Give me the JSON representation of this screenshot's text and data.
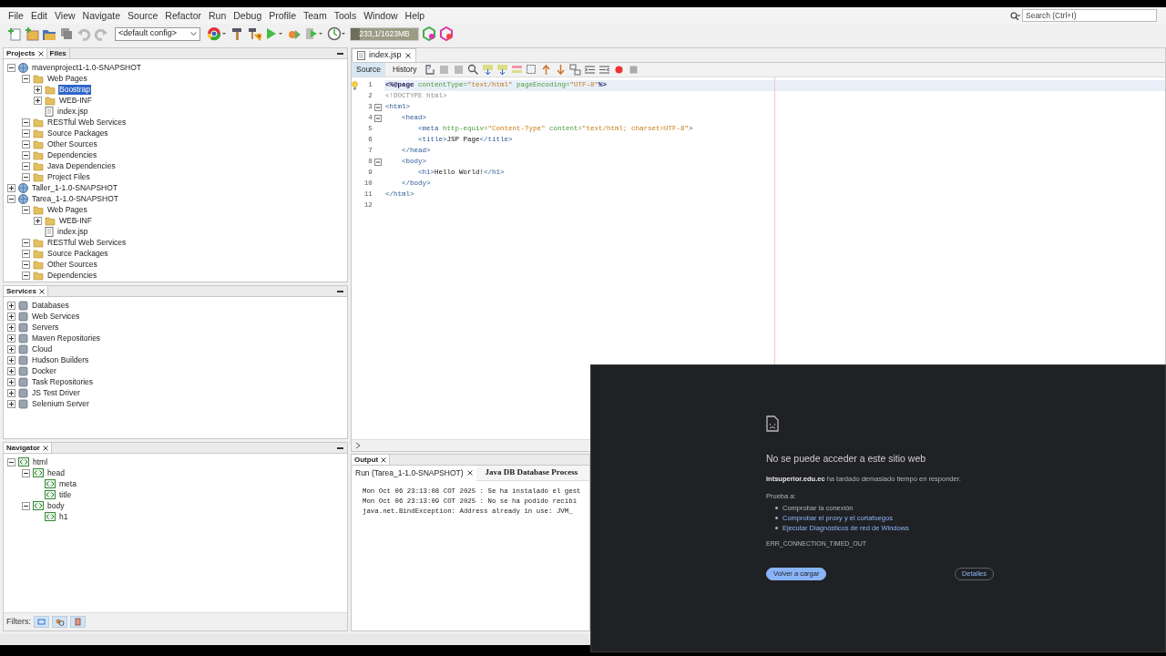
{
  "menu": [
    "File",
    "Edit",
    "View",
    "Navigate",
    "Source",
    "Refactor",
    "Run",
    "Debug",
    "Profile",
    "Team",
    "Tools",
    "Window",
    "Help"
  ],
  "search": {
    "placeholder": "Search (Ctrl+I)"
  },
  "toolbar": {
    "config": "<default config>",
    "memory": {
      "reading": "233,1/1623MB",
      "level": 0.14
    }
  },
  "projects_panel": {
    "tabs": [
      {
        "label": "Projects",
        "selected": true,
        "closable": true
      },
      {
        "label": "Files",
        "selected": false,
        "closable": false
      }
    ],
    "tree": [
      {
        "label": "mavenproject1-1.0-SNAPSHOT",
        "kind": "project",
        "expanded": true,
        "selected": false,
        "children": [
          {
            "label": "Web Pages",
            "kind": "folder",
            "expanded": true,
            "selected": false,
            "children": [
              {
                "label": "Boostrap",
                "kind": "folder",
                "expanded": false,
                "selected": true
              },
              {
                "label": "WEB-INF",
                "kind": "folder",
                "expanded": false,
                "selected": false
              },
              {
                "label": "index.jsp",
                "kind": "file",
                "selected": false
              }
            ]
          },
          {
            "label": "RESTful Web Services",
            "kind": "folder",
            "expanded": true,
            "selected": false
          },
          {
            "label": "Source Packages",
            "kind": "folder",
            "expanded": true,
            "selected": false
          },
          {
            "label": "Other Sources",
            "kind": "folder",
            "expanded": true,
            "selected": false
          },
          {
            "label": "Dependencies",
            "kind": "folder",
            "expanded": true,
            "selected": false
          },
          {
            "label": "Java Dependencies",
            "kind": "folder",
            "expanded": true,
            "selected": false
          },
          {
            "label": "Project Files",
            "kind": "folder",
            "expanded": true,
            "selected": false
          }
        ]
      },
      {
        "label": "Taller_1-1.0-SNAPSHOT",
        "kind": "project",
        "expanded": false,
        "selected": false
      },
      {
        "label": "Tarea_1-1.0-SNAPSHOT",
        "kind": "project",
        "expanded": true,
        "selected": false,
        "children": [
          {
            "label": "Web Pages",
            "kind": "folder",
            "expanded": true,
            "selected": false,
            "children": [
              {
                "label": "WEB-INF",
                "kind": "folder",
                "expanded": false,
                "selected": false
              },
              {
                "label": "index.jsp",
                "kind": "file",
                "selected": false
              }
            ]
          },
          {
            "label": "RESTful Web Services",
            "kind": "folder",
            "expanded": true,
            "selected": false
          },
          {
            "label": "Source Packages",
            "kind": "folder",
            "expanded": true,
            "selected": false
          },
          {
            "label": "Other Sources",
            "kind": "folder",
            "expanded": true,
            "selected": false
          },
          {
            "label": "Dependencies",
            "kind": "folder",
            "expanded": true,
            "selected": false
          }
        ]
      }
    ]
  },
  "services_panel": {
    "title": "Services",
    "items": [
      {
        "label": "Databases",
        "expanded": false
      },
      {
        "label": "Web Services",
        "expanded": false
      },
      {
        "label": "Servers",
        "expanded": false
      },
      {
        "label": "Maven Repositories",
        "expanded": false
      },
      {
        "label": "Cloud",
        "expanded": false
      },
      {
        "label": "Hudson Builders",
        "expanded": false
      },
      {
        "label": "Docker",
        "expanded": false
      },
      {
        "label": "Task Repositories",
        "expanded": false
      },
      {
        "label": "JS Test Driver",
        "expanded": false
      },
      {
        "label": "Selenium Server",
        "expanded": false
      }
    ]
  },
  "navigator_panel": {
    "title": "Navigator",
    "tree": [
      {
        "label": "html",
        "expanded": true,
        "children": [
          {
            "label": "head",
            "expanded": true,
            "children": [
              {
                "label": "meta"
              },
              {
                "label": "title"
              }
            ]
          },
          {
            "label": "body",
            "expanded": true,
            "children": [
              {
                "label": "h1"
              }
            ]
          }
        ]
      }
    ],
    "filters_label": "Filters:",
    "filters": [
      {
        "selected": true
      },
      {
        "selected": true
      },
      {
        "selected": true
      }
    ]
  },
  "editor": {
    "tabs": [
      {
        "label": "index.jsp",
        "selected": true
      }
    ],
    "view_tabs": [
      {
        "label": "Source",
        "selected": true
      },
      {
        "label": "History",
        "selected": false
      }
    ],
    "lines": [
      {
        "number": "1",
        "fold": false,
        "highlighted": true,
        "hint": true,
        "segments": [
          {
            "text": "<%@page",
            "kind": "directive"
          },
          {
            "text": " contentType=",
            "kind": "attr"
          },
          {
            "text": "\"text/html\"",
            "kind": "value"
          },
          {
            "text": " pageEncoding=",
            "kind": "attr"
          },
          {
            "text": "\"UTF-8\"",
            "kind": "value"
          },
          {
            "text": "%>",
            "kind": "directive"
          }
        ]
      },
      {
        "number": "2",
        "fold": false,
        "highlighted": false,
        "hint": false,
        "segments": [
          {
            "text": "<!DOCTYPE html>",
            "kind": "comment"
          }
        ]
      },
      {
        "number": "3",
        "fold": true,
        "highlighted": false,
        "hint": false,
        "segments": [
          {
            "text": "<html>",
            "kind": "tag"
          }
        ]
      },
      {
        "number": "4",
        "fold": true,
        "highlighted": false,
        "hint": false,
        "segments": [
          {
            "text": "    <head>",
            "kind": "tag"
          }
        ]
      },
      {
        "number": "5",
        "fold": false,
        "highlighted": false,
        "hint": false,
        "segments": [
          {
            "text": "        <meta",
            "kind": "tag"
          },
          {
            "text": " http-equiv=",
            "kind": "attr"
          },
          {
            "text": "\"Content-Type\"",
            "kind": "value"
          },
          {
            "text": " content=",
            "kind": "attr"
          },
          {
            "text": "\"text/html; charset=UTF-8\"",
            "kind": "value"
          },
          {
            "text": ">",
            "kind": "tag"
          }
        ]
      },
      {
        "number": "6",
        "fold": false,
        "highlighted": false,
        "hint": false,
        "segments": [
          {
            "text": "        <title>",
            "kind": "tag"
          },
          {
            "text": "JSP Page",
            "kind": "text"
          },
          {
            "text": "</title>",
            "kind": "tag"
          }
        ]
      },
      {
        "number": "7",
        "fold": false,
        "highlighted": false,
        "hint": false,
        "segments": [
          {
            "text": "    </head>",
            "kind": "tag"
          }
        ]
      },
      {
        "number": "8",
        "fold": true,
        "highlighted": false,
        "hint": false,
        "segments": [
          {
            "text": "    <body>",
            "kind": "tag"
          }
        ]
      },
      {
        "number": "9",
        "fold": false,
        "highlighted": false,
        "hint": false,
        "segments": [
          {
            "text": "        <h1>",
            "kind": "tag"
          },
          {
            "text": "Hello World!",
            "kind": "text"
          },
          {
            "text": "</h1>",
            "kind": "tag"
          }
        ]
      },
      {
        "number": "10",
        "fold": false,
        "highlighted": false,
        "hint": false,
        "segments": [
          {
            "text": "    </body>",
            "kind": "tag"
          }
        ]
      },
      {
        "number": "11",
        "fold": false,
        "highlighted": false,
        "hint": false,
        "segments": [
          {
            "text": "</html>",
            "kind": "tag"
          }
        ]
      },
      {
        "number": "12",
        "fold": false,
        "highlighted": false,
        "hint": false
      }
    ]
  },
  "output_panel": {
    "title": "Output",
    "tabs": [
      {
        "label": "Run (Tarea_1-1.0-SNAPSHOT)",
        "selected": true,
        "closable": true
      },
      {
        "label": "Java DB Database Process",
        "selected": false,
        "closable": false
      }
    ],
    "lines": [
      "Mon Oct 06 23:13:08 COT 2025 : Se ha instalado el gest",
      "Mon Oct 06 23:13:09 COT 2025 : No se ha podido recibi",
      "java.net.BindException: Address already in use: JVM_"
    ]
  },
  "browser_error": {
    "title": "No se puede acceder a este sitio web",
    "message": "**intsuperior.edu.ec** ha tardado demasiado tiempo en responder.",
    "suggest_label": "Prueba a:",
    "suggestions": [
      {
        "text": "Comprobar la conexión",
        "kind": "text"
      },
      {
        "text": "Comprobar el proxy y el cortafuegos",
        "kind": "link"
      },
      {
        "text": "Ejecutar Diagnósticos de red de Windows",
        "kind": "link"
      }
    ],
    "error_code": "ERR_CONNECTION_TIMED_OUT",
    "buttons": [
      {
        "label": "Volver a cargar",
        "kind": "primary"
      },
      {
        "label": "Detalles",
        "kind": "outline"
      }
    ]
  }
}
